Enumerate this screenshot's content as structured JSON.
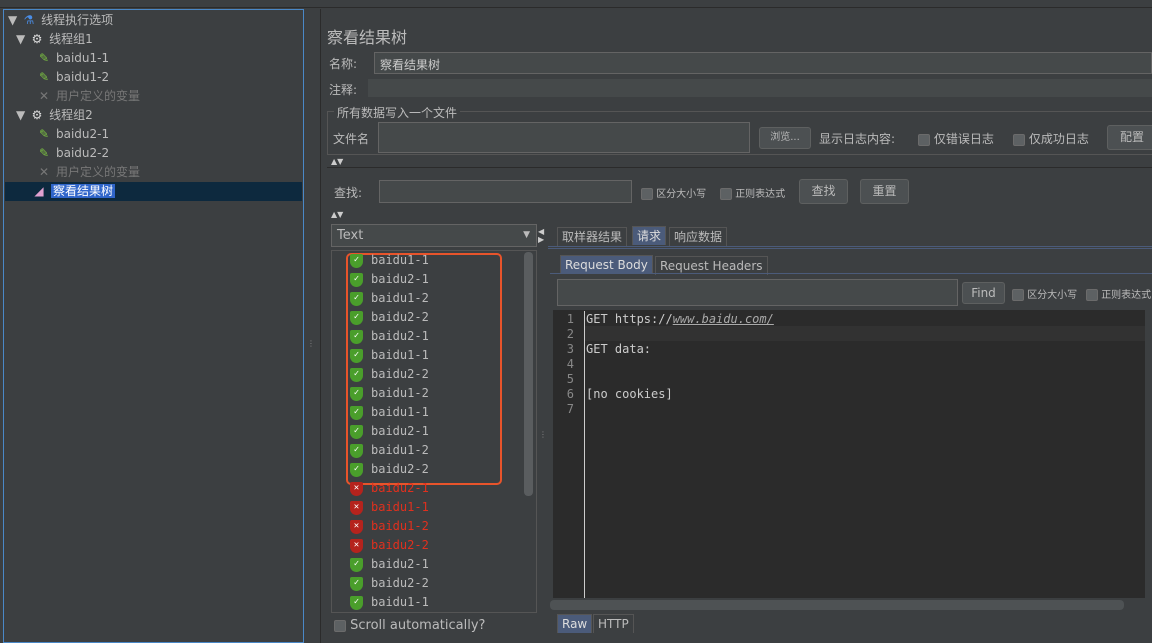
{
  "tree": {
    "root": "线程执行选项",
    "groups": [
      {
        "label": "线程组1",
        "items": [
          "baidu1-1",
          "baidu1-2"
        ],
        "vars": "用户定义的变量"
      },
      {
        "label": "线程组2",
        "items": [
          "baidu2-1",
          "baidu2-2"
        ],
        "vars": "用户定义的变量"
      }
    ],
    "selected": "察看结果树"
  },
  "panel": {
    "title": "察看结果树",
    "name_label": "名称:",
    "name_value": "察看结果树",
    "comment_label": "注释:",
    "file_section": "所有数据写入一个文件",
    "file_label": "文件名",
    "browse": "浏览...",
    "log_label": "显示日志内容:",
    "errors_only": "仅错误日志",
    "success_only": "仅成功日志",
    "config": "配置",
    "search_label": "查找:",
    "case_sensitive": "区分大小写",
    "regex": "正则表达式",
    "find": "查找",
    "reset": "重置"
  },
  "results": {
    "renderer": "Text",
    "items": [
      {
        "label": "baidu1-1",
        "status": "ok"
      },
      {
        "label": "baidu2-1",
        "status": "ok"
      },
      {
        "label": "baidu1-2",
        "status": "ok"
      },
      {
        "label": "baidu2-2",
        "status": "ok"
      },
      {
        "label": "baidu2-1",
        "status": "ok"
      },
      {
        "label": "baidu1-1",
        "status": "ok"
      },
      {
        "label": "baidu2-2",
        "status": "ok"
      },
      {
        "label": "baidu1-2",
        "status": "ok"
      },
      {
        "label": "baidu1-1",
        "status": "ok"
      },
      {
        "label": "baidu2-1",
        "status": "ok"
      },
      {
        "label": "baidu1-2",
        "status": "ok"
      },
      {
        "label": "baidu2-2",
        "status": "ok"
      },
      {
        "label": "baidu2-1",
        "status": "error"
      },
      {
        "label": "baidu1-1",
        "status": "error"
      },
      {
        "label": "baidu1-2",
        "status": "error"
      },
      {
        "label": "baidu2-2",
        "status": "error"
      },
      {
        "label": "baidu2-1",
        "status": "ok"
      },
      {
        "label": "baidu2-2",
        "status": "ok"
      },
      {
        "label": "baidu1-1",
        "status": "ok"
      }
    ],
    "scroll_auto": "Scroll automatically?",
    "highlight_color": "#e8542b"
  },
  "detail": {
    "tabs": [
      "取样器结果",
      "请求",
      "响应数据"
    ],
    "subtabs": [
      "Request Body",
      "Request Headers"
    ],
    "find": "Find",
    "case_sensitive": "区分大小写",
    "regex": "正则表达式",
    "lines": [
      "GET https://www.baidu.com/",
      "",
      "GET data:",
      "",
      "",
      "[no cookies]",
      ""
    ],
    "bottom_tabs": [
      "Raw",
      "HTTP"
    ]
  }
}
